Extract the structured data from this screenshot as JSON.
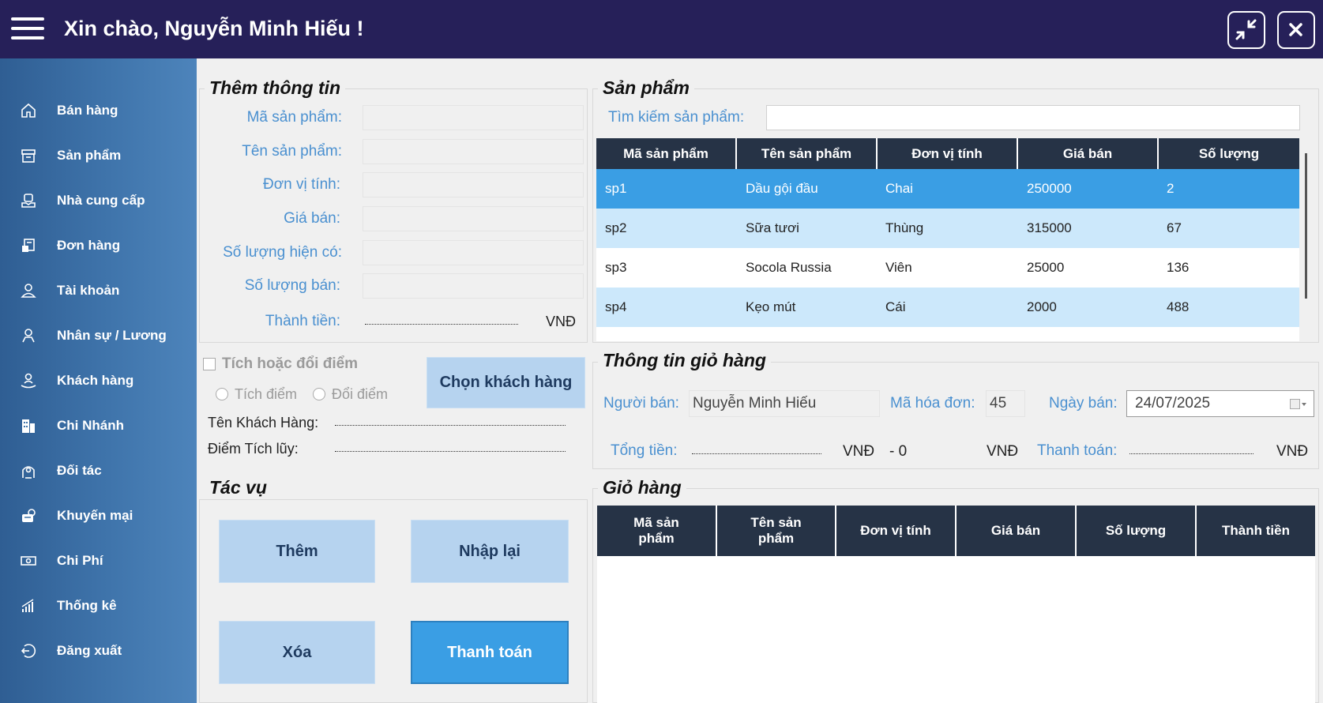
{
  "header": {
    "greeting": "Xin chào, Nguyễn Minh Hiếu !"
  },
  "sidebar": {
    "items": [
      {
        "label": "Bán hàng",
        "icon": "home-icon"
      },
      {
        "label": "Sản phẩm",
        "icon": "box-icon"
      },
      {
        "label": "Nhà cung cấp",
        "icon": "supplier-icon"
      },
      {
        "label": "Đơn hàng",
        "icon": "order-icon"
      },
      {
        "label": "Tài khoản",
        "icon": "account-icon"
      },
      {
        "label": "Nhân sự / Lương",
        "icon": "staff-icon"
      },
      {
        "label": "Khách hàng",
        "icon": "customer-icon"
      },
      {
        "label": "Chi Nhánh",
        "icon": "building-icon"
      },
      {
        "label": "Đối tác",
        "icon": "partner-icon"
      },
      {
        "label": "Khuyến mại",
        "icon": "promotion-icon"
      },
      {
        "label": "Chi Phí",
        "icon": "money-icon"
      },
      {
        "label": "Thống kê",
        "icon": "chart-icon"
      },
      {
        "label": "Đăng xuất",
        "icon": "logout-icon"
      }
    ]
  },
  "add_info": {
    "title": "Thêm thông tin",
    "product_code_label": "Mã sản phẩm:",
    "product_name_label": "Tên sản phẩm:",
    "unit_label": "Đơn vị tính:",
    "price_label": "Giá bán:",
    "stock_label": "Số lượng hiện có:",
    "sell_qty_label": "Số lượng bán:",
    "total_label": "Thành tiền:",
    "currency": "VNĐ"
  },
  "loyalty": {
    "checkbox_label": "Tích hoặc đổi điểm",
    "radio_accumulate": "Tích điểm",
    "radio_redeem": "Đổi điểm",
    "choose_customer": "Chọn khách hàng",
    "customer_name_label": "Tên Khách Hàng:",
    "points_label": "Điểm Tích lũy:"
  },
  "actions": {
    "title": "Tác vụ",
    "add": "Thêm",
    "reset": "Nhập lại",
    "delete": "Xóa",
    "checkout": "Thanh toán"
  },
  "products": {
    "title": "Sản phẩm",
    "search_label": "Tìm kiếm sản phẩm:",
    "columns": [
      "Mã sản phẩm",
      "Tên sản phẩm",
      "Đơn vị tính",
      "Giá bán",
      "Số lượng"
    ],
    "rows": [
      [
        "sp1",
        "Dầu gội đầu",
        "Chai",
        "250000",
        "2"
      ],
      [
        "sp2",
        "Sữa tươi",
        "Thùng",
        "315000",
        "67"
      ],
      [
        "sp3",
        "Socola Russia",
        "Viên",
        "25000",
        "136"
      ],
      [
        "sp4",
        "Kẹo mút",
        "Cái",
        "2000",
        "488"
      ]
    ],
    "selected_row": 0
  },
  "cart_info": {
    "title": "Thông tin giỏ hàng",
    "seller_label": "Người bán:",
    "seller_value": "Nguyễn Minh Hiếu",
    "invoice_label": "Mã hóa đơn:",
    "invoice_value": "45",
    "date_label": "Ngày bán:",
    "date_value": "24/07/2025",
    "total_label": "Tổng tiền:",
    "currency": "VNĐ",
    "discount_value": "- 0",
    "payment_label": "Thanh toán:"
  },
  "cart": {
    "title": "Giỏ hàng",
    "columns": [
      "Mã sản phẩm",
      "Tên sản phẩm",
      "Đơn vị tính",
      "Giá bán",
      "Số lượng",
      "Thành tiền"
    ]
  },
  "colors": {
    "header": "#262059",
    "selected_row": "#3a9ee4",
    "alt_row": "#cce8fb",
    "table_header": "#263346"
  }
}
